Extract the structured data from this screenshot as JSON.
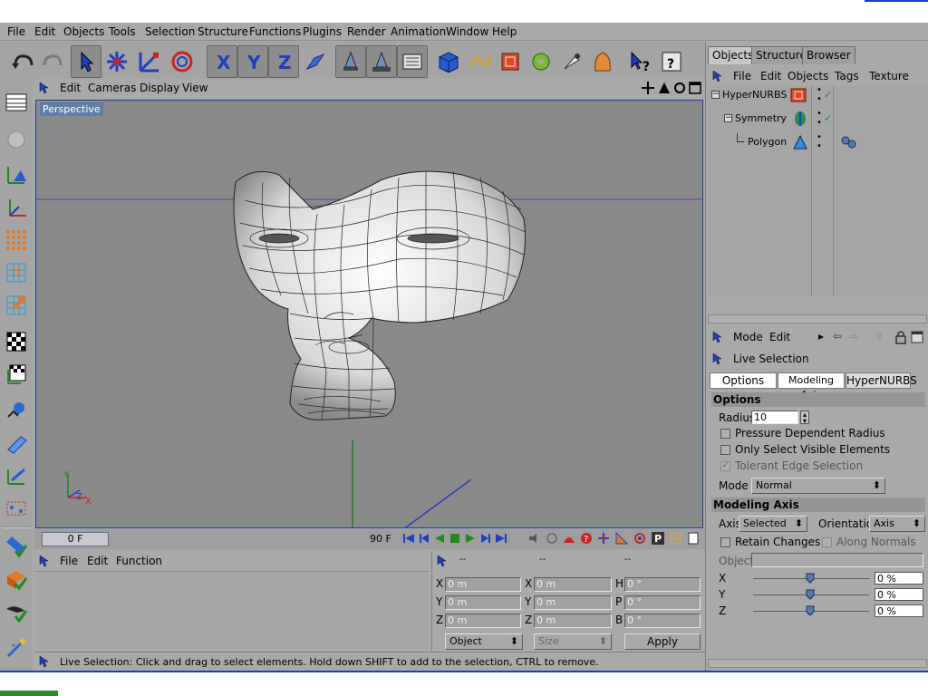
{
  "menubar": {
    "items": [
      "File",
      "Edit",
      "Objects",
      "Tools",
      "Selection",
      "Structure",
      "Functions",
      "Plugins",
      "Render",
      "Animation",
      "Window",
      "Help"
    ]
  },
  "viewport": {
    "menu": [
      "Edit",
      "Cameras",
      "Display",
      "View"
    ],
    "label": "Perspective"
  },
  "timeline": {
    "current_frame": "0 F",
    "end_frame": "90 F"
  },
  "material_manager": {
    "menu": [
      "File",
      "Edit",
      "Function"
    ]
  },
  "coordinates": {
    "header": [
      "--",
      "--",
      "--"
    ],
    "rows": [
      {
        "l1": "X",
        "v1": "0 m",
        "l2": "X",
        "v2": "0 m",
        "l3": "H",
        "v3": "0 °"
      },
      {
        "l1": "Y",
        "v1": "0 m",
        "l2": "Y",
        "v2": "0 m",
        "l3": "P",
        "v3": "0 °"
      },
      {
        "l1": "Z",
        "v1": "0 m",
        "l2": "Z",
        "v2": "0 m",
        "l3": "B",
        "v3": "0 °"
      }
    ],
    "mode_select": "Object",
    "size_select": "Size",
    "apply_label": "Apply"
  },
  "status": {
    "text": "Live Selection: Click and drag to select elements. Hold down SHIFT to add to the selection, CTRL to remove."
  },
  "right_panel": {
    "tabs": [
      "Objects",
      "Structure",
      "Browser"
    ],
    "obj_menu": [
      "File",
      "Edit",
      "Objects",
      "Tags",
      "Texture"
    ],
    "objects": [
      {
        "name": "HyperNURBS"
      },
      {
        "name": "Symmetry"
      },
      {
        "name": "Polygon"
      }
    ]
  },
  "attributes": {
    "menu": [
      "Mode",
      "Edit"
    ],
    "tool_name": "Live Selection",
    "tabs": [
      "Options",
      "Modeling Axis",
      "HyperNURBS"
    ],
    "options_header": "Options",
    "radius_label": "Radius",
    "radius_value": "10",
    "pressure_label": "Pressure Dependent Radius",
    "visible_label": "Only Select Visible Elements",
    "tolerant_label": "Tolerant Edge Selection",
    "mode_label": "Mode",
    "mode_value": "Normal",
    "axis_header": "Modeling Axis",
    "axis_label": "Axis",
    "axis_value": "Selected",
    "orientation_label": "Orientation",
    "orientation_value": "Axis",
    "retain_label": "Retain Changes",
    "along_label": "Along Normals",
    "object_label": "Object",
    "x_label": "X",
    "x_value": "0 %",
    "y_label": "Y",
    "y_value": "0 %",
    "z_label": "Z",
    "z_value": "0 %"
  },
  "colors": {
    "ui_gray": "#a9a9a9",
    "viewport_bg": "#8a8a8a",
    "selection_blue": "#1f3f9f",
    "check_green": "#2a8a2a"
  }
}
